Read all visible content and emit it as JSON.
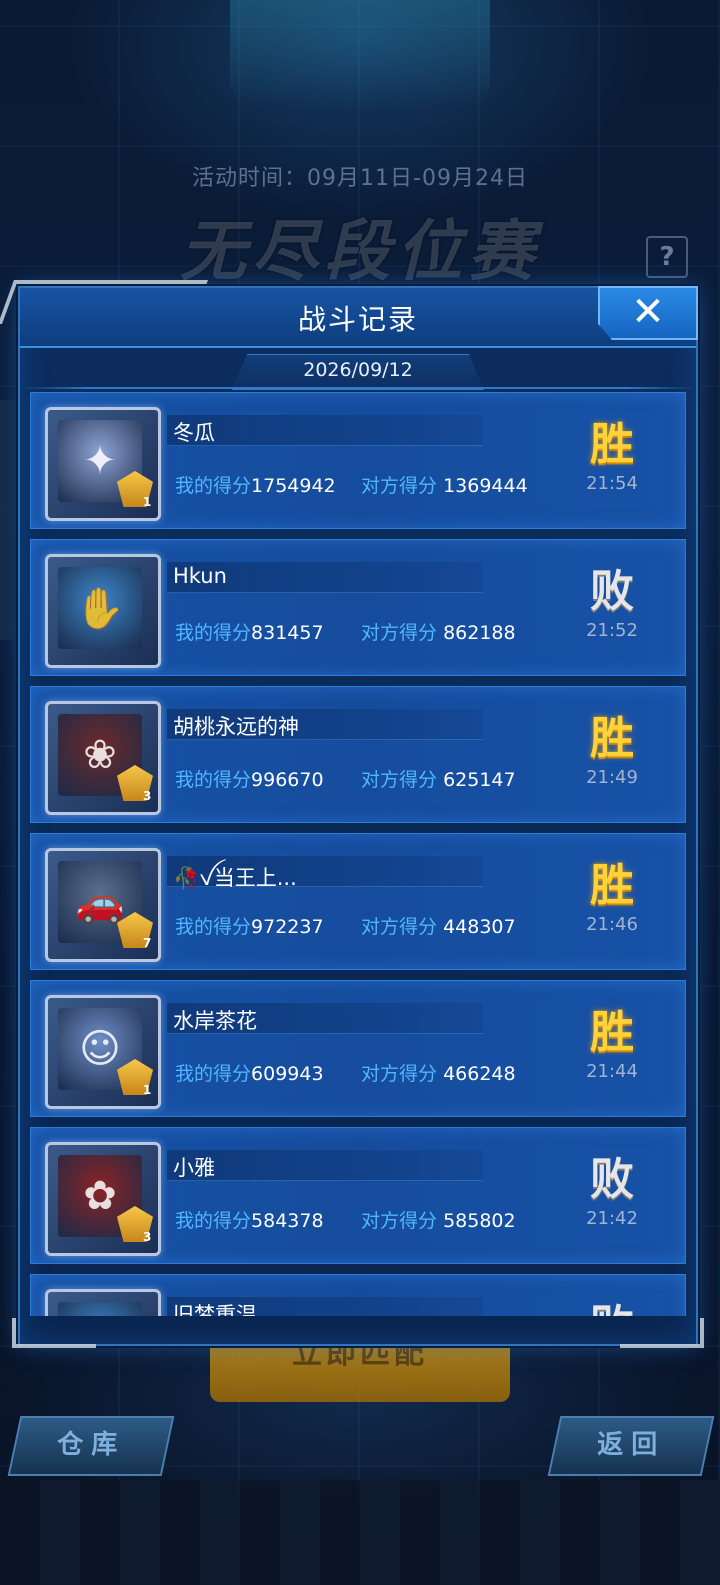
{
  "background": {
    "event_time": "活动时间：09月11日-09月24日",
    "event_title": "无尽段位赛",
    "help_label": "?",
    "match_button": "立即匹配",
    "warehouse_button": "仓库",
    "back_button": "返回"
  },
  "dialog": {
    "title": "战斗记录",
    "close_label": "✕",
    "date": "2026/09/12"
  },
  "labels": {
    "my_score": "我的得分",
    "opp_score": "对方得分"
  },
  "records": [
    {
      "name": "冬瓜",
      "my_score": "1754942",
      "opp_score": "1369444",
      "result": "胜",
      "time": "21:54",
      "rank": "1",
      "avatar_color": "#8fa4d6",
      "avatar_glyph": "✦"
    },
    {
      "name": "Hkun",
      "my_score": "831457",
      "opp_score": "862188",
      "result": "败",
      "time": "21:52",
      "rank": "",
      "avatar_color": "#3c86c9",
      "avatar_glyph": "✋"
    },
    {
      "name": "胡桃永远的神",
      "my_score": "996670",
      "opp_score": "625147",
      "result": "胜",
      "time": "21:49",
      "rank": "3",
      "avatar_color": "#6b2a2a",
      "avatar_glyph": "❀"
    },
    {
      "name": "🥀ꪜ当王上...",
      "my_score": "972237",
      "opp_score": "448307",
      "result": "胜",
      "time": "21:46",
      "rank": "7",
      "avatar_color": "#5a6f8f",
      "avatar_glyph": "🚗"
    },
    {
      "name": "水岸茶花",
      "my_score": "609943",
      "opp_score": "466248",
      "result": "胜",
      "time": "21:44",
      "rank": "1",
      "avatar_color": "#6e8fc7",
      "avatar_glyph": "☺"
    },
    {
      "name": "小雅",
      "my_score": "584378",
      "opp_score": "585802",
      "result": "败",
      "time": "21:42",
      "rank": "3",
      "avatar_color": "#8a2424",
      "avatar_glyph": "✿"
    },
    {
      "name": "旧梦重温",
      "my_score": "",
      "opp_score": "",
      "result": "败",
      "time": "",
      "rank": "",
      "avatar_color": "#3c86c9",
      "avatar_glyph": "☀"
    }
  ],
  "colors": {
    "win": "#ffd23a",
    "lose": "#e6e6e6",
    "score_label": "#4fb6ff",
    "panel": "#0c2d5e",
    "accent": "#2c76c0"
  }
}
